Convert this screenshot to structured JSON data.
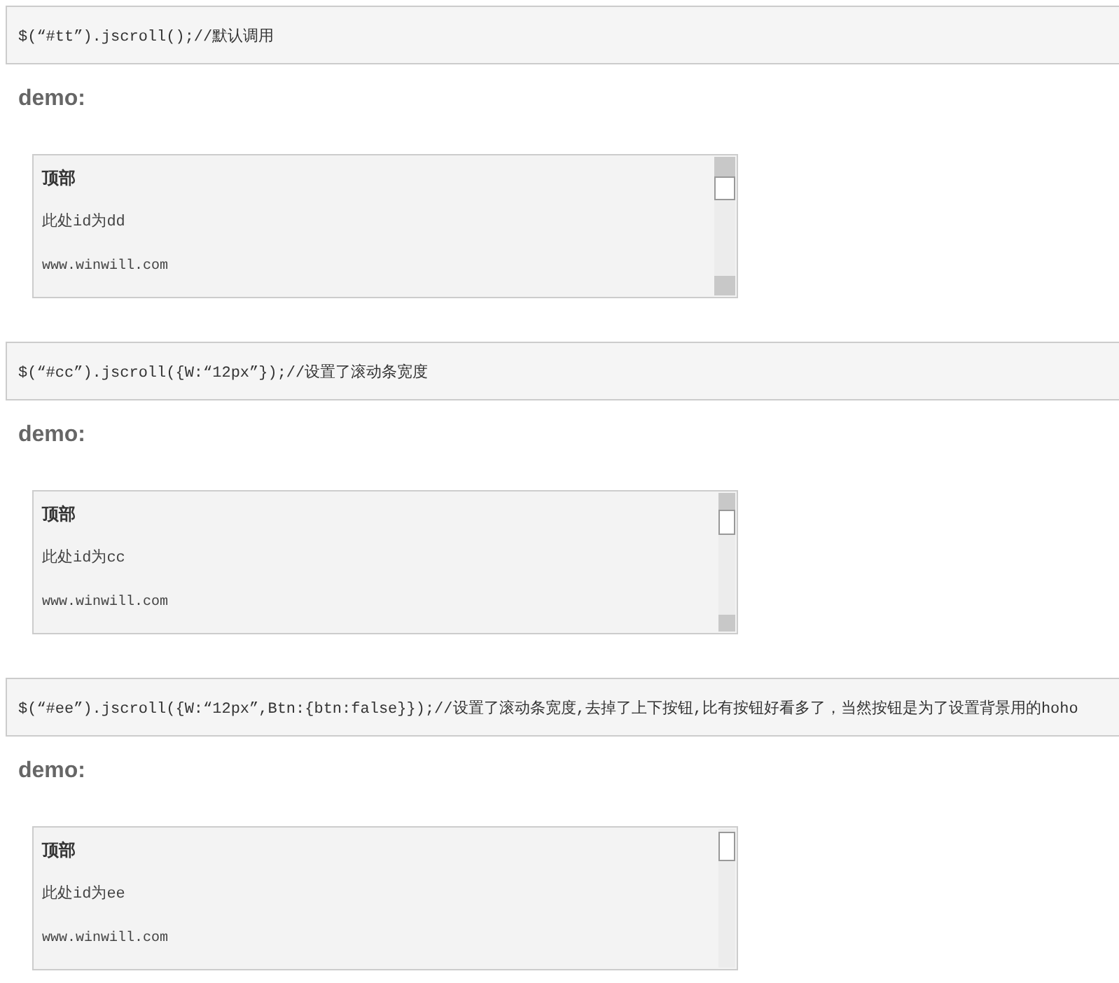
{
  "sections": [
    {
      "code": "$(“#tt”).jscroll();//默认调用",
      "demo_label": "demo:",
      "panel": {
        "title": "顶部",
        "text": "此处id为dd",
        "url": "www.winwill.com",
        "scrollbar": {
          "kind": "standard",
          "buttons": true
        }
      }
    },
    {
      "code": "$(“#cc”).jscroll({W:“12px”});//设置了滚动条宽度",
      "demo_label": "demo:",
      "panel": {
        "title": "顶部",
        "text": "此处id为cc",
        "url": "www.winwill.com",
        "scrollbar": {
          "kind": "narrow",
          "buttons": true
        }
      }
    },
    {
      "code": "$(“#ee”).jscroll({W:“12px”,Btn:{btn:false}});//设置了滚动条宽度,去掉了上下按钮,比有按钮好看多了，当然按钮是为了设置背景用的hoho",
      "demo_label": "demo:",
      "panel": {
        "title": "顶部",
        "text": "此处id为ee",
        "url": "www.winwill.com",
        "scrollbar": {
          "kind": "narrow",
          "buttons": false
        }
      }
    }
  ]
}
